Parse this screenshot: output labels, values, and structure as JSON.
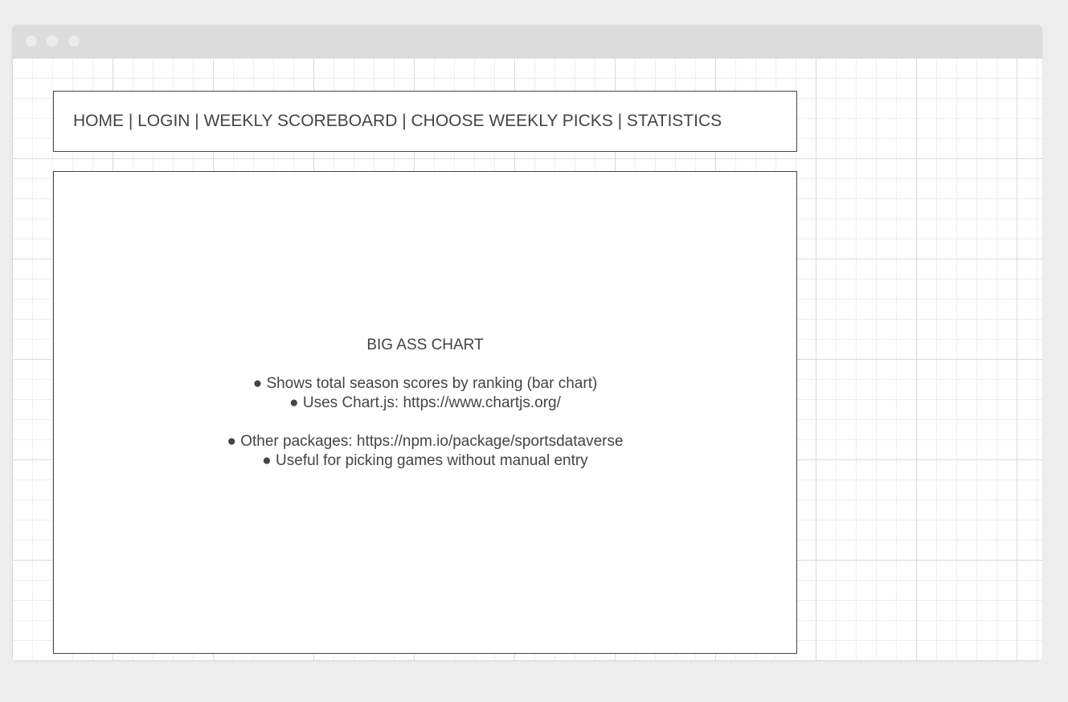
{
  "nav": {
    "text": "HOME | LOGIN | WEEKLY SCOREBOARD | CHOOSE WEEKLY PICKS | STATISTICS"
  },
  "main": {
    "title": "BIG ASS CHART",
    "lines": [
      "● Shows total season scores by ranking (bar chart)",
      "● Uses Chart.js: https://www.chartjs.org/",
      "● Other packages: https://npm.io/package/sportsdataverse",
      "● Useful for picking games without manual entry"
    ]
  },
  "colors": {
    "page_background": "#ededed",
    "titlebar": "#dcdcdc",
    "grid_major": "#d9d9d9",
    "grid_minor": "#efefef",
    "box_border": "#444444",
    "text": "#444444"
  }
}
